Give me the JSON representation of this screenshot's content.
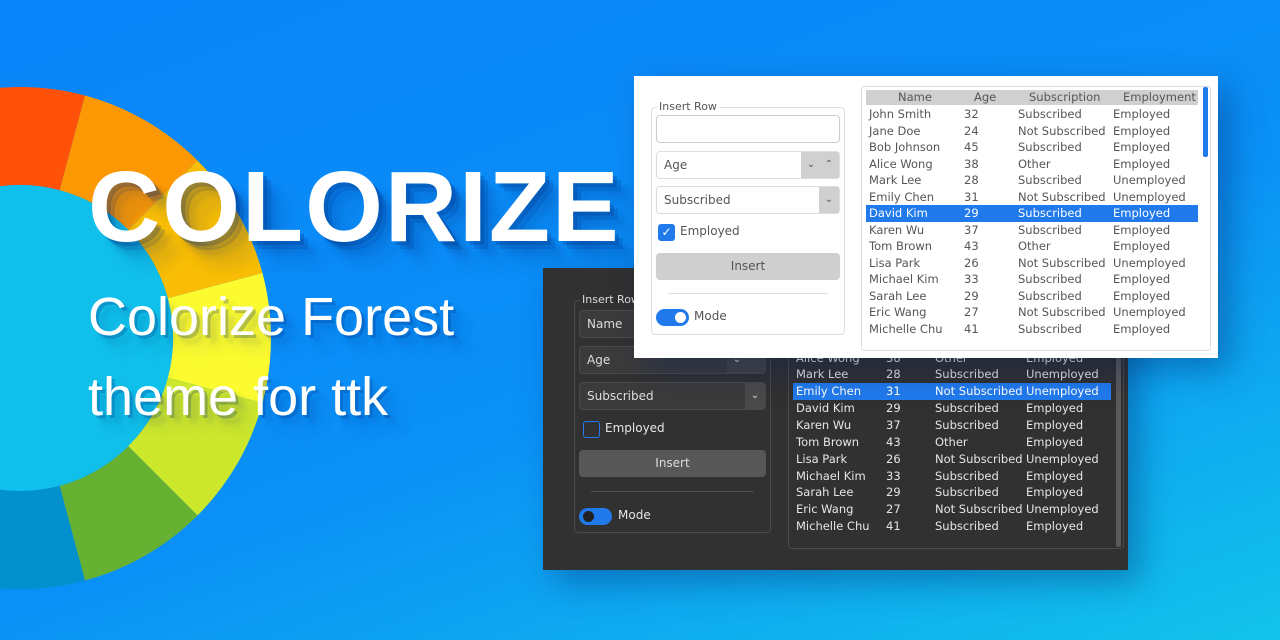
{
  "hero": {
    "title": "COLORIZE",
    "subtitle_line1": "Colorize Forest",
    "subtitle_line2": "theme for ttk"
  },
  "colors": {
    "background_start": "#0a84fa",
    "background_end": "#12c4ea",
    "accent": "#217aeb",
    "wheel_inner": "#10c0eb",
    "wheel_segments": [
      "#ff5208",
      "#fb9804",
      "#f8bd04",
      "#fbfb30",
      "#cde82c",
      "#66b032",
      "#0391ce"
    ]
  },
  "columns": [
    "Name",
    "Age",
    "Subscription",
    "Employment"
  ],
  "rows": [
    [
      "John Smith",
      "32",
      "Subscribed",
      "Employed"
    ],
    [
      "Jane Doe",
      "24",
      "Not Subscribed",
      "Employed"
    ],
    [
      "Bob Johnson",
      "45",
      "Subscribed",
      "Employed"
    ],
    [
      "Alice Wong",
      "38",
      "Other",
      "Employed"
    ],
    [
      "Mark Lee",
      "28",
      "Subscribed",
      "Unemployed"
    ],
    [
      "Emily Chen",
      "31",
      "Not Subscribed",
      "Unemployed"
    ],
    [
      "David Kim",
      "29",
      "Subscribed",
      "Employed"
    ],
    [
      "Karen Wu",
      "37",
      "Subscribed",
      "Employed"
    ],
    [
      "Tom Brown",
      "43",
      "Other",
      "Employed"
    ],
    [
      "Lisa Park",
      "26",
      "Not Subscribed",
      "Unemployed"
    ],
    [
      "Michael Kim",
      "33",
      "Subscribed",
      "Employed"
    ],
    [
      "Sarah Lee",
      "29",
      "Subscribed",
      "Employed"
    ],
    [
      "Eric Wang",
      "27",
      "Not Subscribed",
      "Unemployed"
    ],
    [
      "Michelle Chu",
      "41",
      "Subscribed",
      "Employed"
    ]
  ],
  "light": {
    "group_label": "Insert Row",
    "name_value": "",
    "age_value": "Age",
    "subscription_value": "Subscribed",
    "employed_label": "Employed",
    "employed_checked": true,
    "insert_label": "Insert",
    "mode_label": "Mode",
    "mode_on": true,
    "selected_row": 6
  },
  "dark": {
    "group_label": "Insert Row",
    "name_placeholder": "Name",
    "age_value": "Age",
    "subscription_value": "Subscribed",
    "employed_label": "Employed",
    "employed_checked": false,
    "insert_label": "Insert",
    "mode_label": "Mode",
    "mode_on": false,
    "selected_row": 5
  }
}
